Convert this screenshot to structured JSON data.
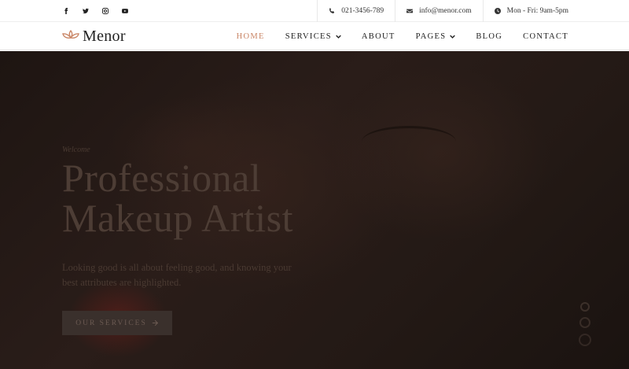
{
  "social_icons": [
    "facebook-icon",
    "twitter-icon",
    "instagram-icon",
    "youtube-icon"
  ],
  "contact": {
    "phone": "021-3456-789",
    "email": "info@menor.com",
    "hours": "Mon - Fri: 9am-5pm"
  },
  "brand": {
    "name": "Menor",
    "accent_color": "#c98565"
  },
  "nav": {
    "items": [
      {
        "label": "HOME",
        "active": true
      },
      {
        "label": "SERVICES",
        "dropdown": true
      },
      {
        "label": "ABOUT"
      },
      {
        "label": "PAGES",
        "dropdown": true
      },
      {
        "label": "BLOG"
      },
      {
        "label": "CONTACT"
      }
    ]
  },
  "hero": {
    "kicker": "Welcome",
    "headline_line1": "Professional",
    "headline_line2": "Makeup Artist",
    "lead": "Looking good is all about feeling good, and knowing your best attributes are highlighted.",
    "cta_label": "OUR SERVICES"
  }
}
